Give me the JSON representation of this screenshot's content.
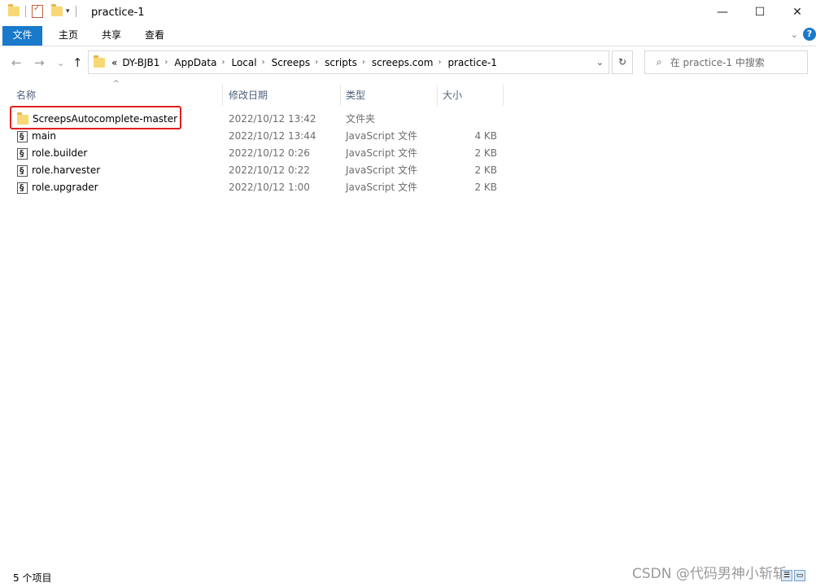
{
  "window": {
    "title": "practice-1",
    "minimize": "—",
    "maximize": "☐",
    "close": "✕"
  },
  "ribbon": {
    "tabs": [
      "文件",
      "主页",
      "共享",
      "查看"
    ],
    "help": "?"
  },
  "nav": {
    "back": "←",
    "forward": "→",
    "recent": "⌄",
    "up": "↑",
    "overflow": "«",
    "breadcrumb": [
      "DY-BJB1",
      "AppData",
      "Local",
      "Screeps",
      "scripts",
      "screeps.com",
      "practice-1"
    ],
    "refresh": "↻",
    "search_placeholder": "在 practice-1 中搜索"
  },
  "columns": {
    "name": "名称",
    "date": "修改日期",
    "type": "类型",
    "size": "大小"
  },
  "files": [
    {
      "name": "ScreepsAutocomplete-master",
      "date": "2022/10/12 13:42",
      "type": "文件夹",
      "size": "",
      "icon": "folder-icon"
    },
    {
      "name": "main",
      "date": "2022/10/12 13:44",
      "type": "JavaScript 文件",
      "size": "4 KB",
      "icon": "js-file-icon"
    },
    {
      "name": "role.builder",
      "date": "2022/10/12 0:26",
      "type": "JavaScript 文件",
      "size": "2 KB",
      "icon": "js-file-icon"
    },
    {
      "name": "role.harvester",
      "date": "2022/10/12 0:22",
      "type": "JavaScript 文件",
      "size": "2 KB",
      "icon": "js-file-icon"
    },
    {
      "name": "role.upgrader",
      "date": "2022/10/12 1:00",
      "type": "JavaScript 文件",
      "size": "2 KB",
      "icon": "js-file-icon"
    }
  ],
  "status": {
    "count": "5 个项目",
    "watermark": "CSDN @代码男神小斩斩"
  },
  "colors": {
    "accent": "#1979ca",
    "highlight": "#e02020",
    "folder": "#f8d775"
  }
}
